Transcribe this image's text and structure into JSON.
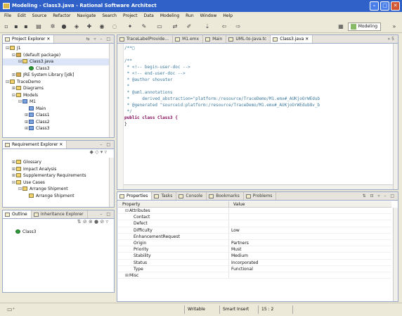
{
  "app": {
    "title": "Modeling - Class3.java - Rational Software Architect"
  },
  "menu": [
    "File",
    "Edit",
    "Source",
    "Refactor",
    "Navigate",
    "Search",
    "Project",
    "Data",
    "Modeling",
    "Run",
    "Window",
    "Help"
  ],
  "toolbar": {
    "perspective": "Modeling"
  },
  "project_explorer": {
    "tab": "Project Explorer",
    "items": [
      {
        "label": "J1",
        "level": 0,
        "toggle": "⊟",
        "icon": "project-icon"
      },
      {
        "label": "(default package)",
        "level": 1,
        "toggle": "⊟",
        "icon": "package-icon"
      },
      {
        "label": "Class3.java",
        "level": 2,
        "toggle": "⊟",
        "icon": "java-file-icon",
        "selected": true
      },
      {
        "label": "Class3",
        "level": 3,
        "toggle": "",
        "icon": "class-icon"
      },
      {
        "label": "JRE System Library [jdk]",
        "level": 1,
        "toggle": "⊞",
        "icon": "library-icon"
      },
      {
        "label": "TraceDemo",
        "level": 0,
        "toggle": "⊟",
        "icon": "project-icon"
      },
      {
        "label": "Diagrams",
        "level": 1,
        "toggle": "⊞",
        "icon": "folder-icon"
      },
      {
        "label": "Models",
        "level": 1,
        "toggle": "⊟",
        "icon": "folder-icon"
      },
      {
        "label": "M1",
        "level": 2,
        "toggle": "⊟",
        "icon": "model-icon"
      },
      {
        "label": "Main",
        "level": 3,
        "toggle": "",
        "icon": "diagram-icon"
      },
      {
        "label": "Class1",
        "level": 3,
        "toggle": "⊞",
        "icon": "uml-class-icon"
      },
      {
        "label": "Class2",
        "level": 3,
        "toggle": "⊞",
        "icon": "uml-class-icon"
      },
      {
        "label": "Class3",
        "level": 3,
        "toggle": "⊞",
        "icon": "uml-class-icon"
      }
    ]
  },
  "requirement_explorer": {
    "tab": "Requirement Explorer",
    "items": [
      {
        "label": "Glossary",
        "level": 1,
        "toggle": "⊞"
      },
      {
        "label": "Impact Analysis",
        "level": 1,
        "toggle": "⊞"
      },
      {
        "label": "Supplementary Requirements",
        "level": 1,
        "toggle": "⊞"
      },
      {
        "label": "Use Cases",
        "level": 1,
        "toggle": "⊟"
      },
      {
        "label": "Arrange Shipment",
        "level": 2,
        "toggle": "⊟"
      },
      {
        "label": "Arrange Shipment",
        "level": 3,
        "toggle": ""
      }
    ]
  },
  "outline": {
    "tabs": [
      "Outline",
      "Inheritance Explorer"
    ],
    "items": [
      "Class3"
    ]
  },
  "editor": {
    "tabs": [
      {
        "label": "TraceLabelProvide...",
        "active": false
      },
      {
        "label": "M1.emx",
        "active": false
      },
      {
        "label": "Main",
        "active": false
      },
      {
        "label": "UML-to-Java.tc",
        "active": false
      },
      {
        "label": "Class3.java",
        "active": true
      }
    ],
    "more": "»5",
    "lines": [
      {
        "text": "/**□",
        "kind": "cm"
      },
      {
        "text": "",
        "kind": ""
      },
      {
        "text": "/**",
        "kind": "cm"
      },
      {
        "text": " * <!-- begin-user-doc -->",
        "kind": "cm"
      },
      {
        "text": " * <!-- end-user-doc -->",
        "kind": "cm"
      },
      {
        "text": " * @author shovater",
        "kind": "cm"
      },
      {
        "text": " *",
        "kind": "cm"
      },
      {
        "text": " * @uml.annotations",
        "kind": "cm"
      },
      {
        "text": " *     derived_abstraction=\"platform:/resource/TraceDemo/M1.emx#_AUKjoOrWEdub",
        "kind": "cm"
      },
      {
        "text": " * @generated \"sourceid:platform:/resource/TraceDemo/M1.emx#_AUKjoOrWEdub8v_b",
        "kind": "cm"
      },
      {
        "text": " */",
        "kind": "cm"
      },
      {
        "text": "public class Class3 {",
        "kind": "kw"
      },
      {
        "text": "}",
        "kind": ""
      }
    ]
  },
  "properties": {
    "tabs": [
      "Properties",
      "Tasks",
      "Console",
      "Bookmarks",
      "Problems"
    ],
    "col_property": "Property",
    "col_value": "Value",
    "rows": [
      {
        "key": "Attributes",
        "value": "",
        "group": true,
        "toggle": "⊟"
      },
      {
        "key": "Contact",
        "value": ""
      },
      {
        "key": "Defect",
        "value": ""
      },
      {
        "key": "Difficulty",
        "value": "Low"
      },
      {
        "key": "EnhancementRequest",
        "value": ""
      },
      {
        "key": "Origin",
        "value": "Partners"
      },
      {
        "key": "Priority",
        "value": "Must"
      },
      {
        "key": "Stability",
        "value": "Medium"
      },
      {
        "key": "Status",
        "value": "Incorporated"
      },
      {
        "key": "Type",
        "value": "Functional"
      },
      {
        "key": "Misc",
        "value": "",
        "group": true,
        "toggle": "⊞"
      }
    ]
  },
  "status": {
    "mode": "Writable",
    "insert": "Smart Insert",
    "pos": "15 : 2"
  }
}
